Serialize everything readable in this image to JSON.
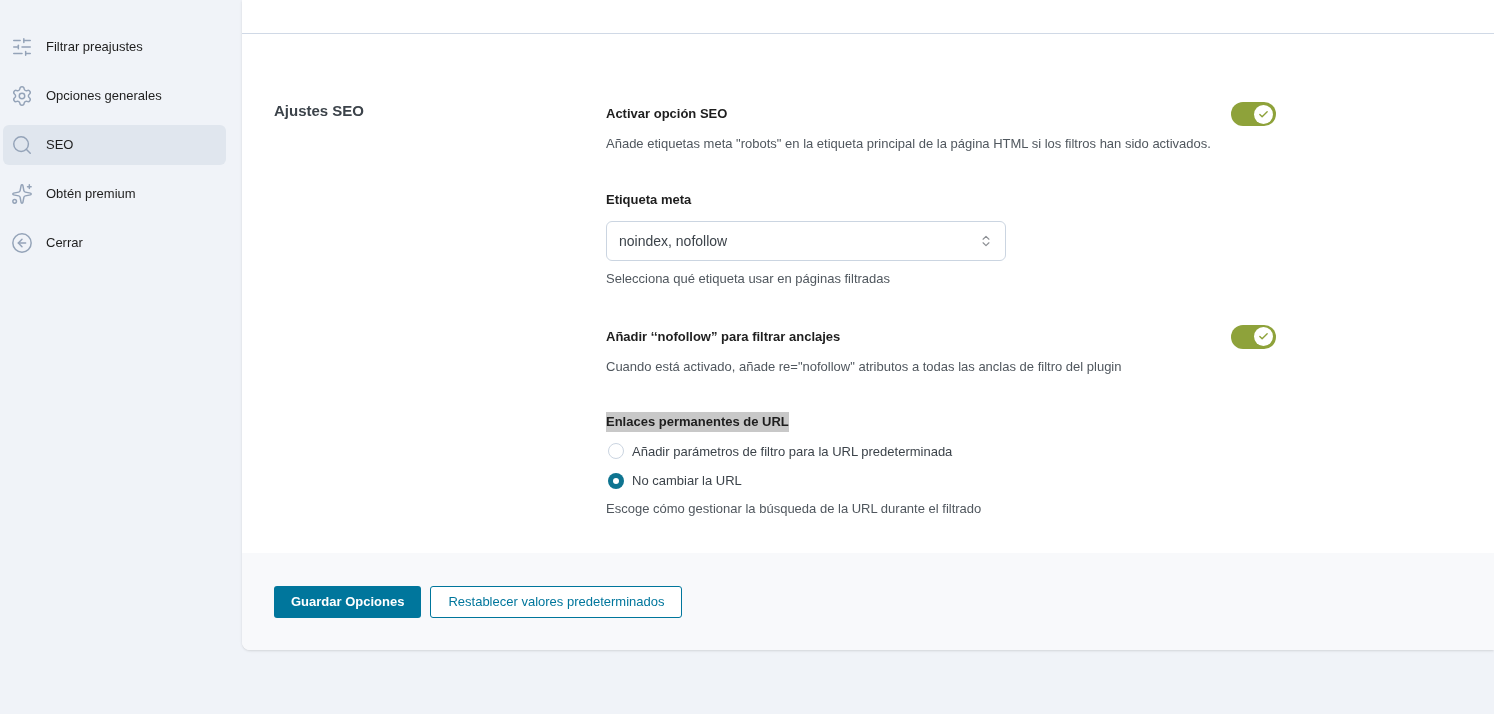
{
  "sidebar": {
    "items": [
      {
        "label": "Filtrar preajustes",
        "selected": false
      },
      {
        "label": "Opciones generales",
        "selected": false
      },
      {
        "label": "SEO",
        "selected": true
      },
      {
        "label": "Obtén premium",
        "selected": false
      },
      {
        "label": "Cerrar",
        "selected": false
      }
    ]
  },
  "section": {
    "title": "Ajustes SEO",
    "settings": [
      {
        "kind": "toggle",
        "label": "Activar opción SEO",
        "on": true,
        "description": "Añade etiquetas meta \"robots\" en la etiqueta principal de la página HTML si los filtros han sido activados."
      },
      {
        "kind": "select",
        "label": "Etiqueta meta",
        "value": "noindex, nofollow",
        "description": "Selecciona qué etiqueta usar en páginas filtradas"
      },
      {
        "kind": "toggle",
        "label": "Añadir ‘‘nofollow” para filtrar anclajes",
        "on": true,
        "description": "Cuando está activado, añade re=\"nofollow\" atributos a todas las anclas de filtro del plugin"
      },
      {
        "kind": "radio",
        "label": "Enlaces permanentes de URL",
        "highlighted": true,
        "options": [
          {
            "label": "Añadir parámetros de filtro para la URL predeterminada",
            "selected": false
          },
          {
            "label": "No cambiar la URL",
            "selected": true
          }
        ],
        "description": "Escoge cómo gestionar la búsqueda de la URL durante el filtrado"
      }
    ]
  },
  "footer": {
    "buttons": [
      {
        "label": "Guardar Opciones",
        "kind": "primary"
      },
      {
        "label": "Restablecer valores predeterminados",
        "kind": "secondary"
      }
    ]
  }
}
